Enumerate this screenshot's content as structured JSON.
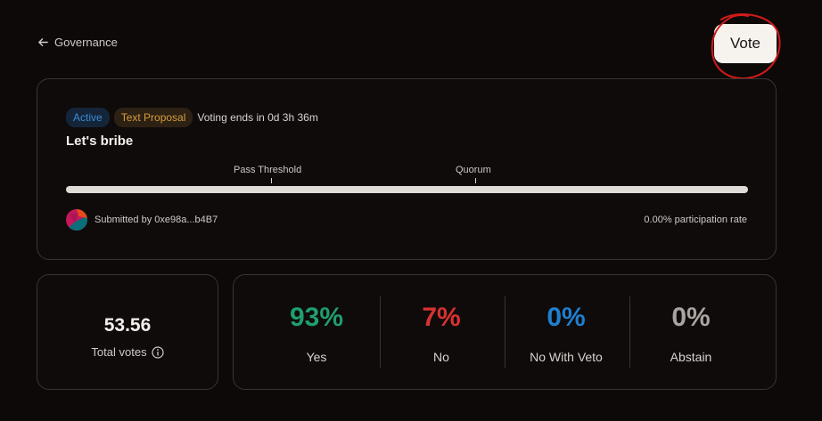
{
  "nav": {
    "back_label": "Governance"
  },
  "actions": {
    "vote_label": "Vote"
  },
  "proposal": {
    "status_tag": "Active",
    "type_tag": "Text Proposal",
    "voting_ends": "Voting ends in 0d 3h 36m",
    "title": "Let's bribe",
    "pass_threshold_label": "Pass Threshold",
    "quorum_label": "Quorum",
    "submitted_by": "Submitted by 0xe98a...b4B7",
    "participation": "0.00% participation rate"
  },
  "totals": {
    "value": "53.56",
    "label": "Total votes"
  },
  "results": [
    {
      "pct": "93%",
      "label": "Yes",
      "color": "#1f9e6e"
    },
    {
      "pct": "7%",
      "label": "No",
      "color": "#d6322f"
    },
    {
      "pct": "0%",
      "label": "No With Veto",
      "color": "#1e7fd0"
    },
    {
      "pct": "0%",
      "label": "Abstain",
      "color": "#a8a4a1"
    }
  ],
  "colors": {
    "accent_active": "#3d8ad3",
    "accent_text_proposal": "#d59c3a",
    "annotation": "#d11a1a"
  }
}
